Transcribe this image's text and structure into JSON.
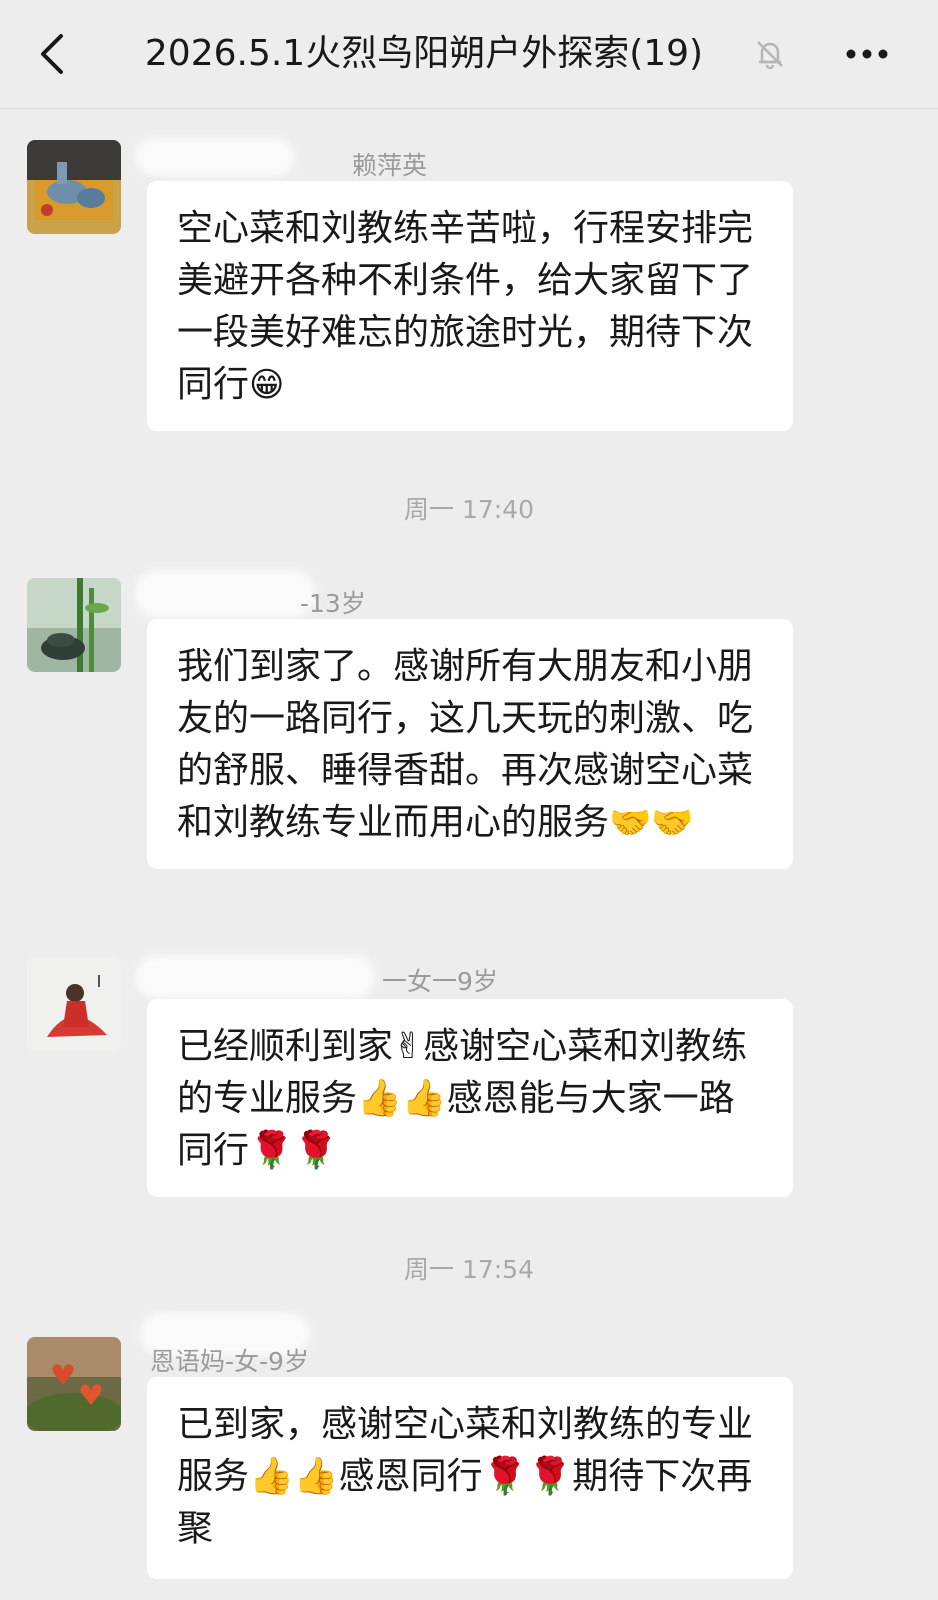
{
  "header": {
    "title": "2026.5.1火烈鸟阳朔户外探索(19)",
    "back_icon": "chevron-left-icon",
    "mute_icon": "bell-off-icon",
    "more_icon": "more-dots-icon"
  },
  "messages": [
    {
      "sender": "赖萍英",
      "text": "空心菜和刘教练辛苦啦，行程安排完美避开各种不利条件，给大家留下了一段美好难忘的旅途时光，期待下次同行",
      "emoji": "😁"
    },
    {
      "timestamp": "周一 17:40"
    },
    {
      "sender": "-13岁",
      "text": "我们到家了。感谢所有大朋友和小朋友的一路同行，这几天玩的刺激、吃的舒服、睡得香甜。再次感谢空心菜和刘教练专业而用心的服务",
      "emoji": "🤝🤝"
    },
    {
      "sender": "一女一9岁",
      "text": "已经顺利到家✌感谢空心菜和刘教练的专业服务👍👍感恩能与大家一路同行🌹🌹"
    },
    {
      "timestamp": "周一 17:54"
    },
    {
      "sender": "恩语妈-女-9岁",
      "text": "已到家，感谢空心菜和刘教练的专业服务👍👍感恩同行🌹🌹期待下次再聚"
    }
  ],
  "colors": {
    "background": "#ededed",
    "bubble": "#ffffff",
    "text": "#191919",
    "meta": "#a9a9a9"
  }
}
